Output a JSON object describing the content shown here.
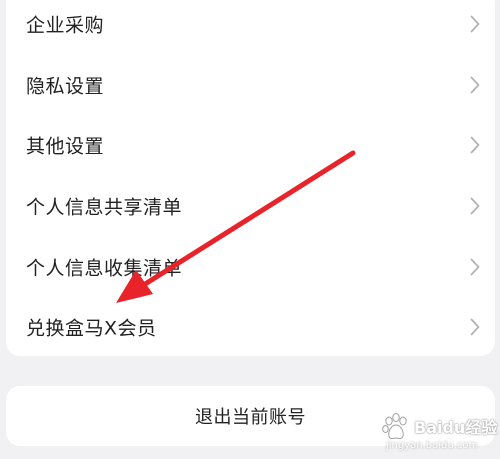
{
  "menu": {
    "items": [
      {
        "label": "企业采购"
      },
      {
        "label": "隐私设置"
      },
      {
        "label": "其他设置"
      },
      {
        "label": "个人信息共享清单"
      },
      {
        "label": "个人信息收集清单"
      },
      {
        "label": "兑换盒马X会员"
      }
    ]
  },
  "logout": {
    "label": "退出当前账号"
  },
  "watermark": {
    "text": "Baidu经验",
    "url": "jingyan.baidu.com"
  },
  "colors": {
    "background": "#f1f1f3",
    "card": "#ffffff",
    "text": "#222222",
    "chevron": "#b3b3b3",
    "annotation_arrow": "#e8232a"
  },
  "icons": {
    "row_chevron": "chevron-right-icon",
    "annotation": "red-arrow-annotation"
  }
}
